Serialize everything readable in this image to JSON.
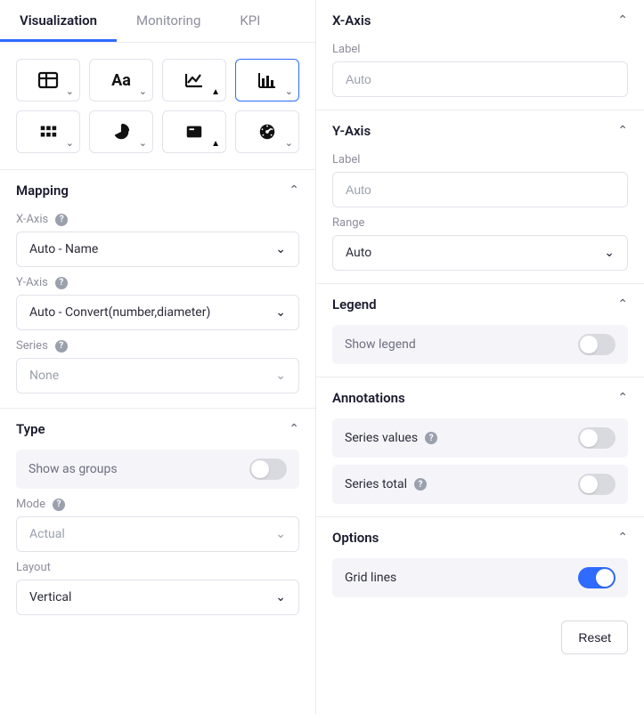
{
  "tabs": {
    "visualization": "Visualization",
    "monitoring": "Monitoring",
    "kpi": "KPI"
  },
  "viz_icons": {
    "table": "table",
    "text": "text",
    "line": "line-chart",
    "bar": "bar-chart",
    "grid": "grid",
    "pie": "pie",
    "card": "card",
    "gauge": "gauge"
  },
  "mapping": {
    "title": "Mapping",
    "xaxis_label": "X-Axis",
    "xaxis_value": "Auto - Name",
    "yaxis_label": "Y-Axis",
    "yaxis_value": "Auto - Convert(number,diameter)",
    "series_label": "Series",
    "series_value": "None"
  },
  "type": {
    "title": "Type",
    "show_groups_label": "Show as groups",
    "mode_label": "Mode",
    "mode_value": "Actual",
    "layout_label": "Layout",
    "layout_value": "Vertical"
  },
  "xaxis": {
    "title": "X-Axis",
    "label_label": "Label",
    "placeholder": "Auto"
  },
  "yaxis": {
    "title": "Y-Axis",
    "label_label": "Label",
    "placeholder": "Auto",
    "range_label": "Range",
    "range_value": "Auto"
  },
  "legend": {
    "title": "Legend",
    "show_label": "Show legend"
  },
  "annotations": {
    "title": "Annotations",
    "series_values_label": "Series values",
    "series_total_label": "Series total"
  },
  "options": {
    "title": "Options",
    "gridlines_label": "Grid lines"
  },
  "reset": "Reset"
}
